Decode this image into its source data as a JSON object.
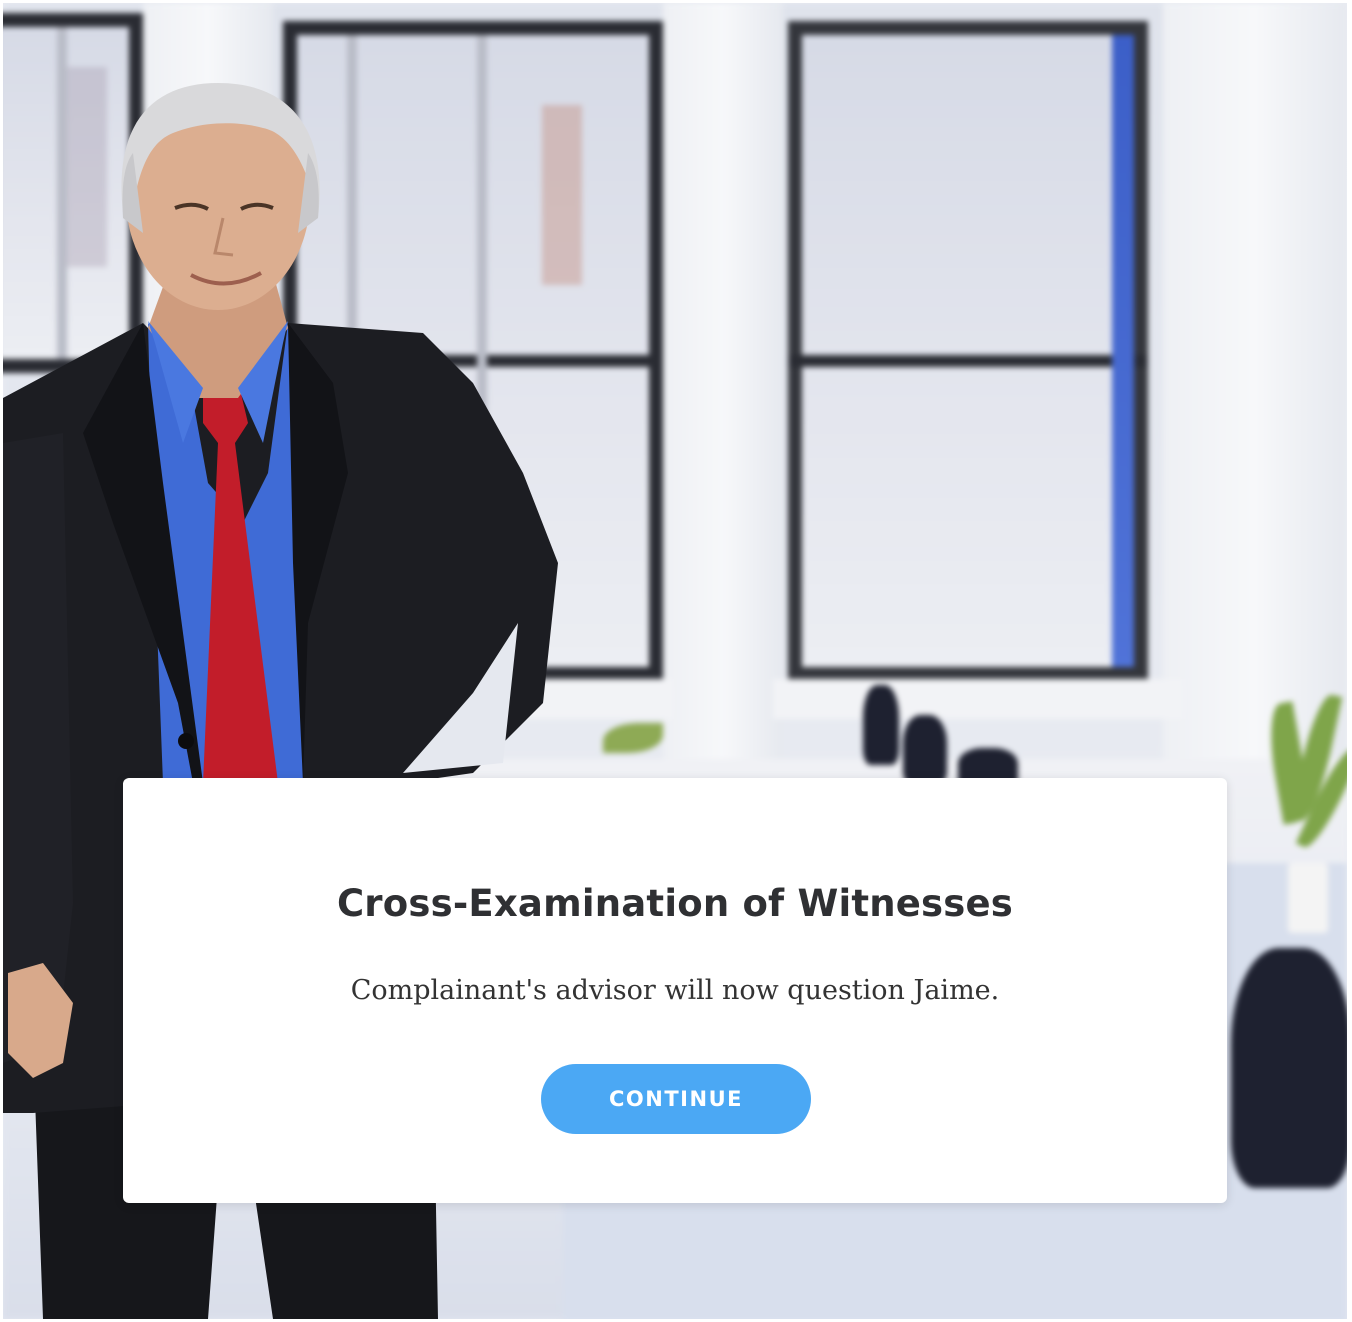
{
  "scene": {
    "background": "office-room-background",
    "character": "presenter-in-suit"
  },
  "dialog": {
    "title": "Cross-Examination of Witnesses",
    "message": "Complainant's advisor will now question Jaime.",
    "button_label": "CONTINUE"
  },
  "colors": {
    "button": "#4ba8f4",
    "title_text": "#2f3033",
    "body_text": "#333333",
    "card": "#ffffff"
  }
}
